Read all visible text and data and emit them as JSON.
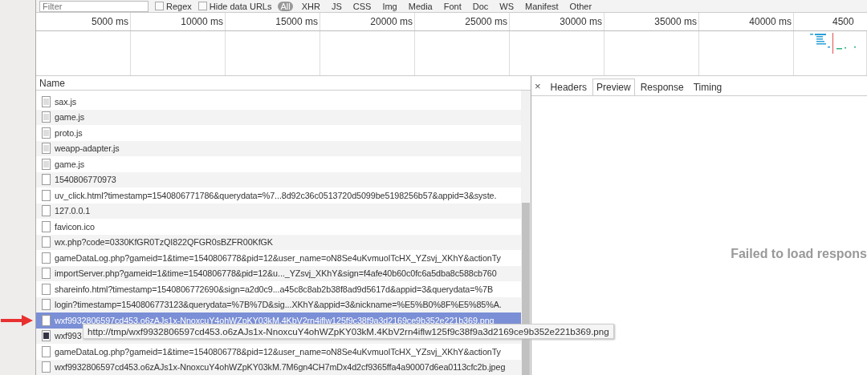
{
  "toolbar": {
    "filter": {
      "placeholder": "Filter"
    },
    "checkboxes": [
      {
        "label": "Regex",
        "checked": false
      },
      {
        "label": "Hide data URLs",
        "checked": false
      }
    ],
    "types": [
      {
        "label": "All",
        "selected": true
      },
      {
        "label": "XHR",
        "selected": false
      },
      {
        "label": "JS",
        "selected": false
      },
      {
        "label": "CSS",
        "selected": false
      },
      {
        "label": "Img",
        "selected": false
      },
      {
        "label": "Media",
        "selected": false
      },
      {
        "label": "Font",
        "selected": false
      },
      {
        "label": "Doc",
        "selected": false
      },
      {
        "label": "WS",
        "selected": false
      },
      {
        "label": "Manifest",
        "selected": false
      },
      {
        "label": "Other",
        "selected": false
      }
    ]
  },
  "timeline": {
    "ticks": [
      "5000 ms",
      "10000 ms",
      "15000 ms",
      "20000 ms",
      "25000 ms",
      "30000 ms",
      "35000 ms",
      "40000 ms",
      "4500"
    ]
  },
  "requests": {
    "column": "Name",
    "rows": [
      {
        "name": "sax.js",
        "kind": "script",
        "selected": false
      },
      {
        "name": "game.js",
        "kind": "script",
        "selected": false
      },
      {
        "name": "proto.js",
        "kind": "script",
        "selected": false
      },
      {
        "name": "weapp-adapter.js",
        "kind": "script",
        "selected": false
      },
      {
        "name": "game.js",
        "kind": "script",
        "selected": false
      },
      {
        "name": "1540806770973",
        "kind": "other",
        "selected": false
      },
      {
        "name": "uv_click.html?timestamp=1540806771786&querydata=%7...8d92c36c0513720d5099be5198256b57&appid=3&syste.",
        "kind": "other",
        "selected": false
      },
      {
        "name": "127.0.0.1",
        "kind": "other",
        "selected": false
      },
      {
        "name": "favicon.ico",
        "kind": "other",
        "selected": false
      },
      {
        "name": "wx.php?code=0330KfGR0TzQI822QFGR0sBZFR00KfGK",
        "kind": "other",
        "selected": false
      },
      {
        "name": "gameDataLog.php?gameid=1&time=1540806778&pid=12&user_name=oN8Se4uKvmuoITcHX_YZsvj_XKhY&actionTy",
        "kind": "other",
        "selected": false
      },
      {
        "name": "importServer.php?gameid=1&time=1540806778&pid=12&u..._YZsvj_XKhY&sign=f4afe40b60c0fc6a5dba8c588cb760",
        "kind": "other",
        "selected": false
      },
      {
        "name": "shareinfo.html?timestamp=1540806772690&sign=a2d0c9...a45c8c8ab2b38f8ad9d5617d&appid=3&querydata=%7B",
        "kind": "other",
        "selected": false
      },
      {
        "name": "login?timestamp=1540806773123&querydata=%7B%7D&sig...XKhY&appid=3&nickname=%E5%B0%8F%E5%85%A.",
        "kind": "other",
        "selected": false
      },
      {
        "name": "wxf9932806597cd453.o6zAJs1x-NnoxcuY4ohWZpKY03kM.4KbV2rn4iflw125f9c38f9a3d2169ce9b352e221b369.png",
        "kind": "other",
        "selected": true
      },
      {
        "name": "wxf993",
        "kind": "image",
        "selected": false
      },
      {
        "name": "gameDataLog.php?gameid=1&time=1540806778&pid=12&user_name=oN8Se4uKvmuoITcHX_YZsvj_XKhY&actionTy",
        "kind": "other",
        "selected": false
      },
      {
        "name": "wxf9932806597cd453.o6zAJs1x-NnoxcuY4ohWZpKY03kM.7M6gn4CH7mDx4d2cf9365ffa4a90007d6ea0113cfc2b.jpeg",
        "kind": "other",
        "selected": false
      }
    ],
    "tooltip": "http://tmp/wxf9932806597cd453.o6zAJs1x-NnoxcuY4ohWZpKY03kM.4KbV2rn4iflw125f9c38f9a3d2169ce9b352e221b369.png"
  },
  "details": {
    "close": "×",
    "tabs": [
      {
        "label": "Headers",
        "selected": false
      },
      {
        "label": "Preview",
        "selected": true
      },
      {
        "label": "Response",
        "selected": false
      },
      {
        "label": "Timing",
        "selected": false
      }
    ],
    "message": "Failed to load respons"
  }
}
